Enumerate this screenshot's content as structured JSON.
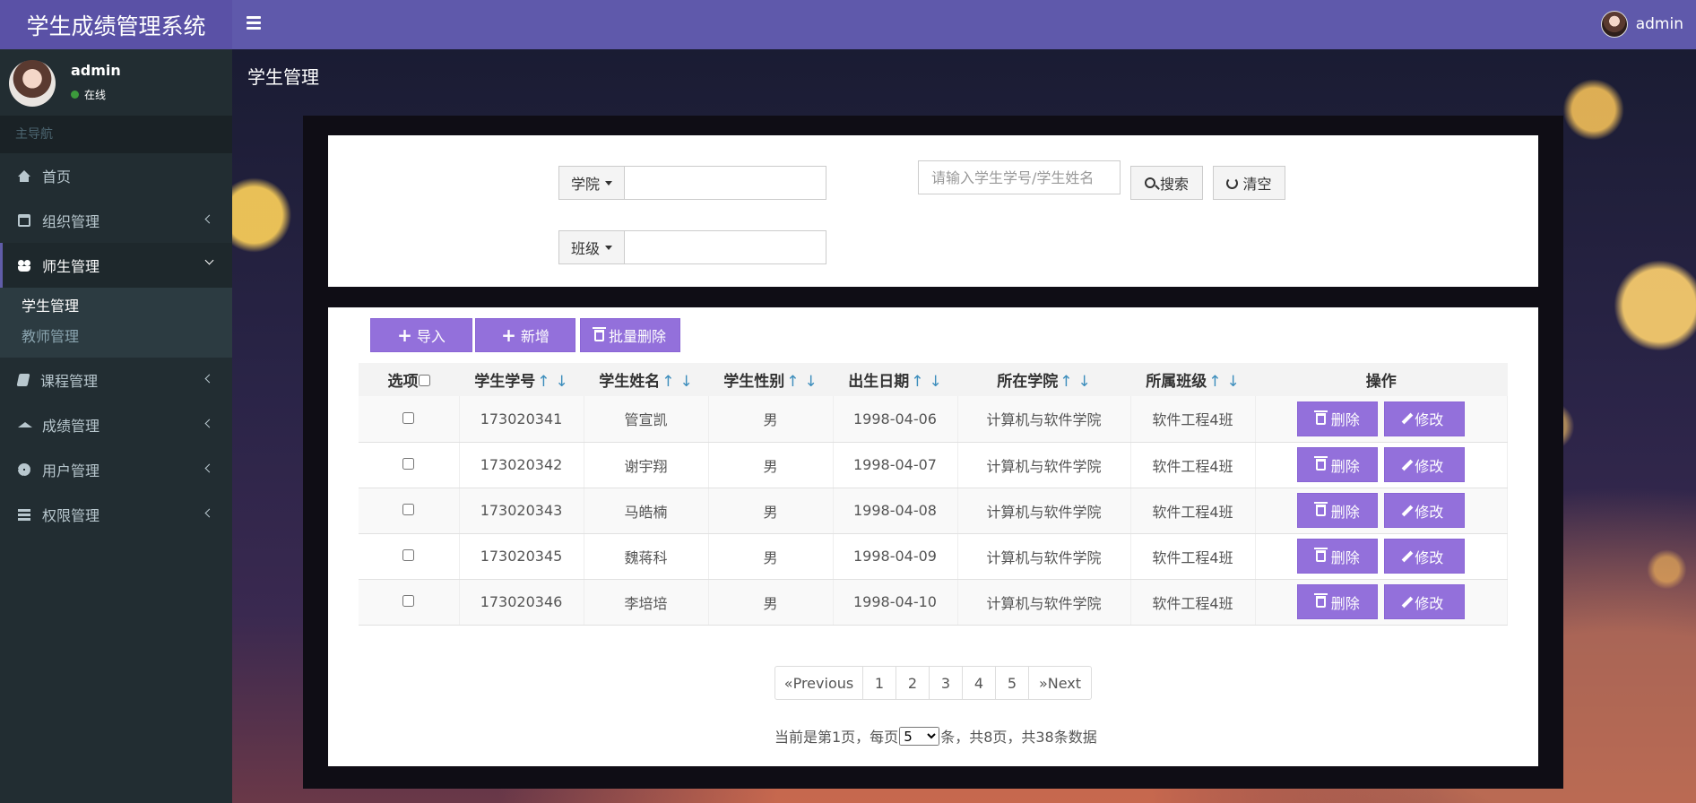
{
  "app": {
    "title": "学生成绩管理系统"
  },
  "topbar": {
    "username": "admin"
  },
  "sidebar": {
    "user": {
      "name": "admin",
      "status": "在线"
    },
    "header": "主导航",
    "items": [
      {
        "label": "首页",
        "icon": "home-icon"
      },
      {
        "label": "组织管理",
        "icon": "calendar-icon"
      },
      {
        "label": "师生管理",
        "icon": "users-icon",
        "sub": [
          "学生管理",
          "教师管理"
        ]
      },
      {
        "label": "课程管理",
        "icon": "book-icon"
      },
      {
        "label": "成绩管理",
        "icon": "graduation-cap-icon"
      },
      {
        "label": "用户管理",
        "icon": "gear-icon"
      },
      {
        "label": "权限管理",
        "icon": "list-icon"
      }
    ]
  },
  "page": {
    "title": "学生管理"
  },
  "search": {
    "college_label": "学院",
    "class_label": "班级",
    "keyword_placeholder": "请输入学生学号/学生姓名",
    "search_label": "搜索",
    "clear_label": "清空"
  },
  "toolbar": {
    "import_label": "导入",
    "add_label": "新增",
    "batch_delete_label": "批量删除"
  },
  "table": {
    "columns": [
      "选项",
      "学生学号",
      "学生姓名",
      "学生性别",
      "出生日期",
      "所在学院",
      "所属班级",
      "操作"
    ],
    "sort_up": "↑",
    "sort_down": "↓",
    "rows": [
      [
        "173020341",
        "管宣凯",
        "男",
        "1998-04-06",
        "计算机与软件学院",
        "软件工程4班"
      ],
      [
        "173020342",
        "谢宇翔",
        "男",
        "1998-04-07",
        "计算机与软件学院",
        "软件工程4班"
      ],
      [
        "173020343",
        "马皓楠",
        "男",
        "1998-04-08",
        "计算机与软件学院",
        "软件工程4班"
      ],
      [
        "173020345",
        "魏蒋科",
        "男",
        "1998-04-09",
        "计算机与软件学院",
        "软件工程4班"
      ],
      [
        "173020346",
        "李培培",
        "男",
        "1998-04-10",
        "计算机与软件学院",
        "软件工程4班"
      ]
    ],
    "delete_label": "删除",
    "edit_label": "修改"
  },
  "pagination": {
    "prev": "«Previous",
    "pages": [
      "1",
      "2",
      "3",
      "4",
      "5"
    ],
    "next": "»Next",
    "info_prefix": "当前是第1页，每页",
    "per_page": "5",
    "info_suffix": "条，共8页，共38条数据"
  },
  "colors": {
    "accent": "#9370db",
    "header": "#5f59ab",
    "sidebar": "#222d32"
  }
}
